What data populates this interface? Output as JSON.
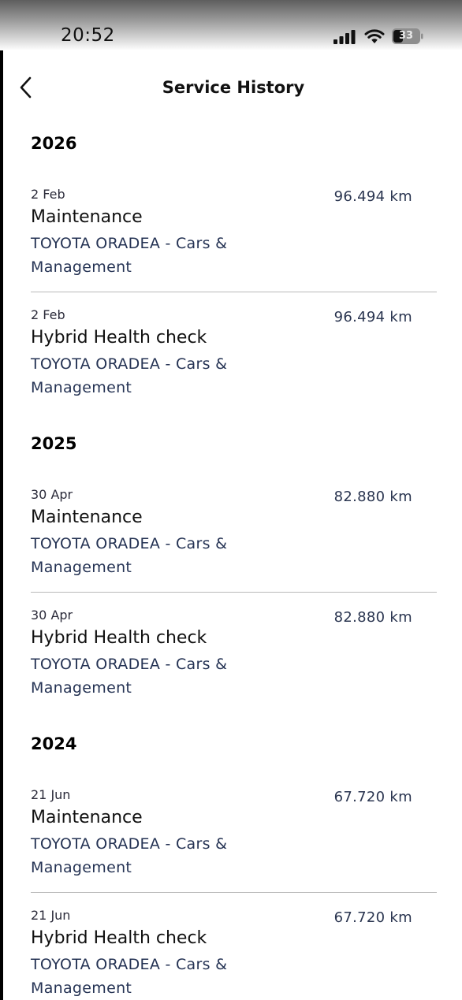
{
  "status_bar": {
    "time": "20:52",
    "battery": "33"
  },
  "header": {
    "title": "Service History",
    "back_icon": "chevron-left-icon"
  },
  "years": [
    {
      "year": "2026",
      "records": [
        {
          "date": "2 Feb",
          "type": "Maintenance",
          "dealer": "TOYOTA ORADEA - Cars & Management",
          "km": "96.494 km"
        },
        {
          "date": "2 Feb",
          "type": "Hybrid Health check",
          "dealer": "TOYOTA ORADEA - Cars & Management",
          "km": "96.494 km"
        }
      ]
    },
    {
      "year": "2025",
      "records": [
        {
          "date": "30 Apr",
          "type": "Maintenance",
          "dealer": "TOYOTA ORADEA - Cars & Management",
          "km": "82.880 km"
        },
        {
          "date": "30 Apr",
          "type": "Hybrid Health check",
          "dealer": "TOYOTA ORADEA - Cars & Management",
          "km": "82.880 km"
        }
      ]
    },
    {
      "year": "2024",
      "records": [
        {
          "date": "21 Jun",
          "type": "Maintenance",
          "dealer": "TOYOTA ORADEA - Cars & Management",
          "km": "67.720 km"
        },
        {
          "date": "21 Jun",
          "type": "Hybrid Health check",
          "dealer": "TOYOTA ORADEA - Cars & Management",
          "km": "67.720 km"
        }
      ]
    }
  ],
  "colors": {
    "text_primary": "#111111",
    "text_dealer": "#253354",
    "divider": "#b9b9b9"
  }
}
